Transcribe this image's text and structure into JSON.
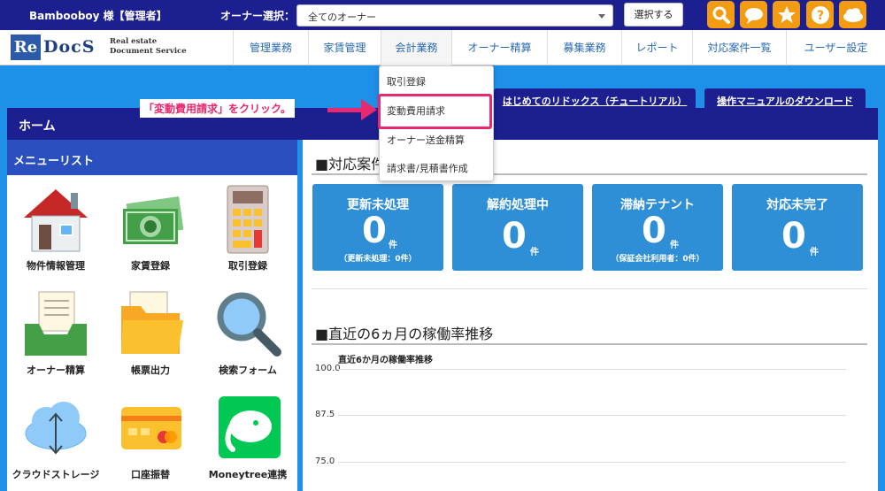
{
  "topbar": {
    "user": "Bambooboy 様【管理者】",
    "owner_label": "オーナー選択：",
    "owner_select_value": "全てのオーナー",
    "select_button": "選択する",
    "icons": [
      "search-icon",
      "chat-icon",
      "star-icon",
      "help-icon",
      "cloud-icon"
    ],
    "icon_color": "#f39c12"
  },
  "logo": {
    "mark": "Re",
    "text": "DocS",
    "sub1": "Real estate",
    "sub2": "Document Service"
  },
  "nav": [
    "管理業務",
    "家賃管理",
    "会計業務",
    "オーナー精算",
    "募集業務",
    "レポート",
    "対応案件一覧",
    "ユーザー設定"
  ],
  "dropdown": [
    "取引登録",
    "変動費用請求",
    "オーナー送金精算",
    "請求書/見積書作成"
  ],
  "callout": "「変動費用請求」をクリック。",
  "tabs": {
    "tutorial": "はじめてのリドックス（チュートリアル）",
    "manual": "操作マニュアルのダウンロード"
  },
  "home_title": "ホーム",
  "menu": {
    "heading": "メニューリスト",
    "items": [
      {
        "label": "物件情報管理",
        "icon": "house-icon"
      },
      {
        "label": "家賃登録",
        "icon": "money-icon"
      },
      {
        "label": "取引登録",
        "icon": "calculator-icon"
      },
      {
        "label": "オーナー精算",
        "icon": "inbox-tray-icon"
      },
      {
        "label": "帳票出力",
        "icon": "folder-icon"
      },
      {
        "label": "検索フォーム",
        "icon": "magnifier-icon"
      },
      {
        "label": "クラウドストレージ",
        "icon": "cloud-storage-icon"
      },
      {
        "label": "口座振替",
        "icon": "credit-card-icon"
      },
      {
        "label": "Moneytree連携",
        "icon": "moneytree-elephant-icon"
      }
    ]
  },
  "cases": {
    "title": "■対応案件",
    "cards": [
      {
        "title": "更新未処理",
        "value": "0",
        "unit": "件",
        "sub": "（更新未処理：0件）"
      },
      {
        "title": "解約処理中",
        "value": "0",
        "unit": "件",
        "sub": ""
      },
      {
        "title": "滞納テナント",
        "value": "0",
        "unit": "件",
        "sub": "（保証会社利用者：0件）"
      },
      {
        "title": "対応未完了",
        "value": "0",
        "unit": "件",
        "sub": ""
      }
    ]
  },
  "occupancy": {
    "title": "■直近の6ヵ月の稼働率推移",
    "chart_title": "直近6か月の稼働率推移",
    "ticks": [
      "100.0",
      "87.5",
      "75.0"
    ]
  }
}
